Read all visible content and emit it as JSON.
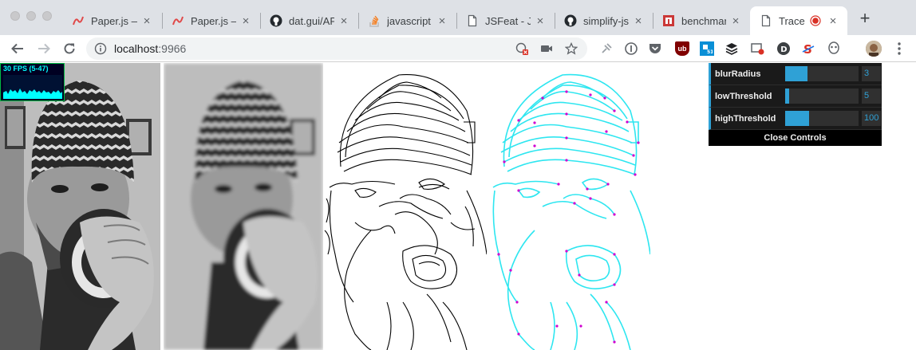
{
  "tabs": [
    {
      "title": "Paper.js — ",
      "favicon": "paperjs-icon"
    },
    {
      "title": "Paper.js — ",
      "favicon": "paperjs-icon"
    },
    {
      "title": "dat.gui/API",
      "favicon": "github-icon"
    },
    {
      "title": "javascript",
      "favicon": "stackoverflow-icon"
    },
    {
      "title": "JSFeat - J",
      "favicon": "page-icon"
    },
    {
      "title": "simplify-js",
      "favicon": "github-icon"
    },
    {
      "title": "benchmar",
      "favicon": "npm-icon"
    },
    {
      "title": "Trace",
      "favicon": "page-icon",
      "active": true,
      "recording": true
    }
  ],
  "toolbar": {
    "url_host": "localhost",
    "url_port": ":9966"
  },
  "stats": {
    "fps_label": "30 FPS (5-47)"
  },
  "gui": {
    "controls": [
      {
        "name": "blurRadius",
        "value": "3",
        "fill": 0.3
      },
      {
        "name": "lowThreshold",
        "value": "5",
        "fill": 0.05
      },
      {
        "name": "highThreshold",
        "value": "100",
        "fill": 0.33
      }
    ],
    "close_label": "Close Controls"
  },
  "colors": {
    "accent": "#2fa1d6",
    "trace_line": "#2ee6f0",
    "trace_point": "#d000d0"
  }
}
